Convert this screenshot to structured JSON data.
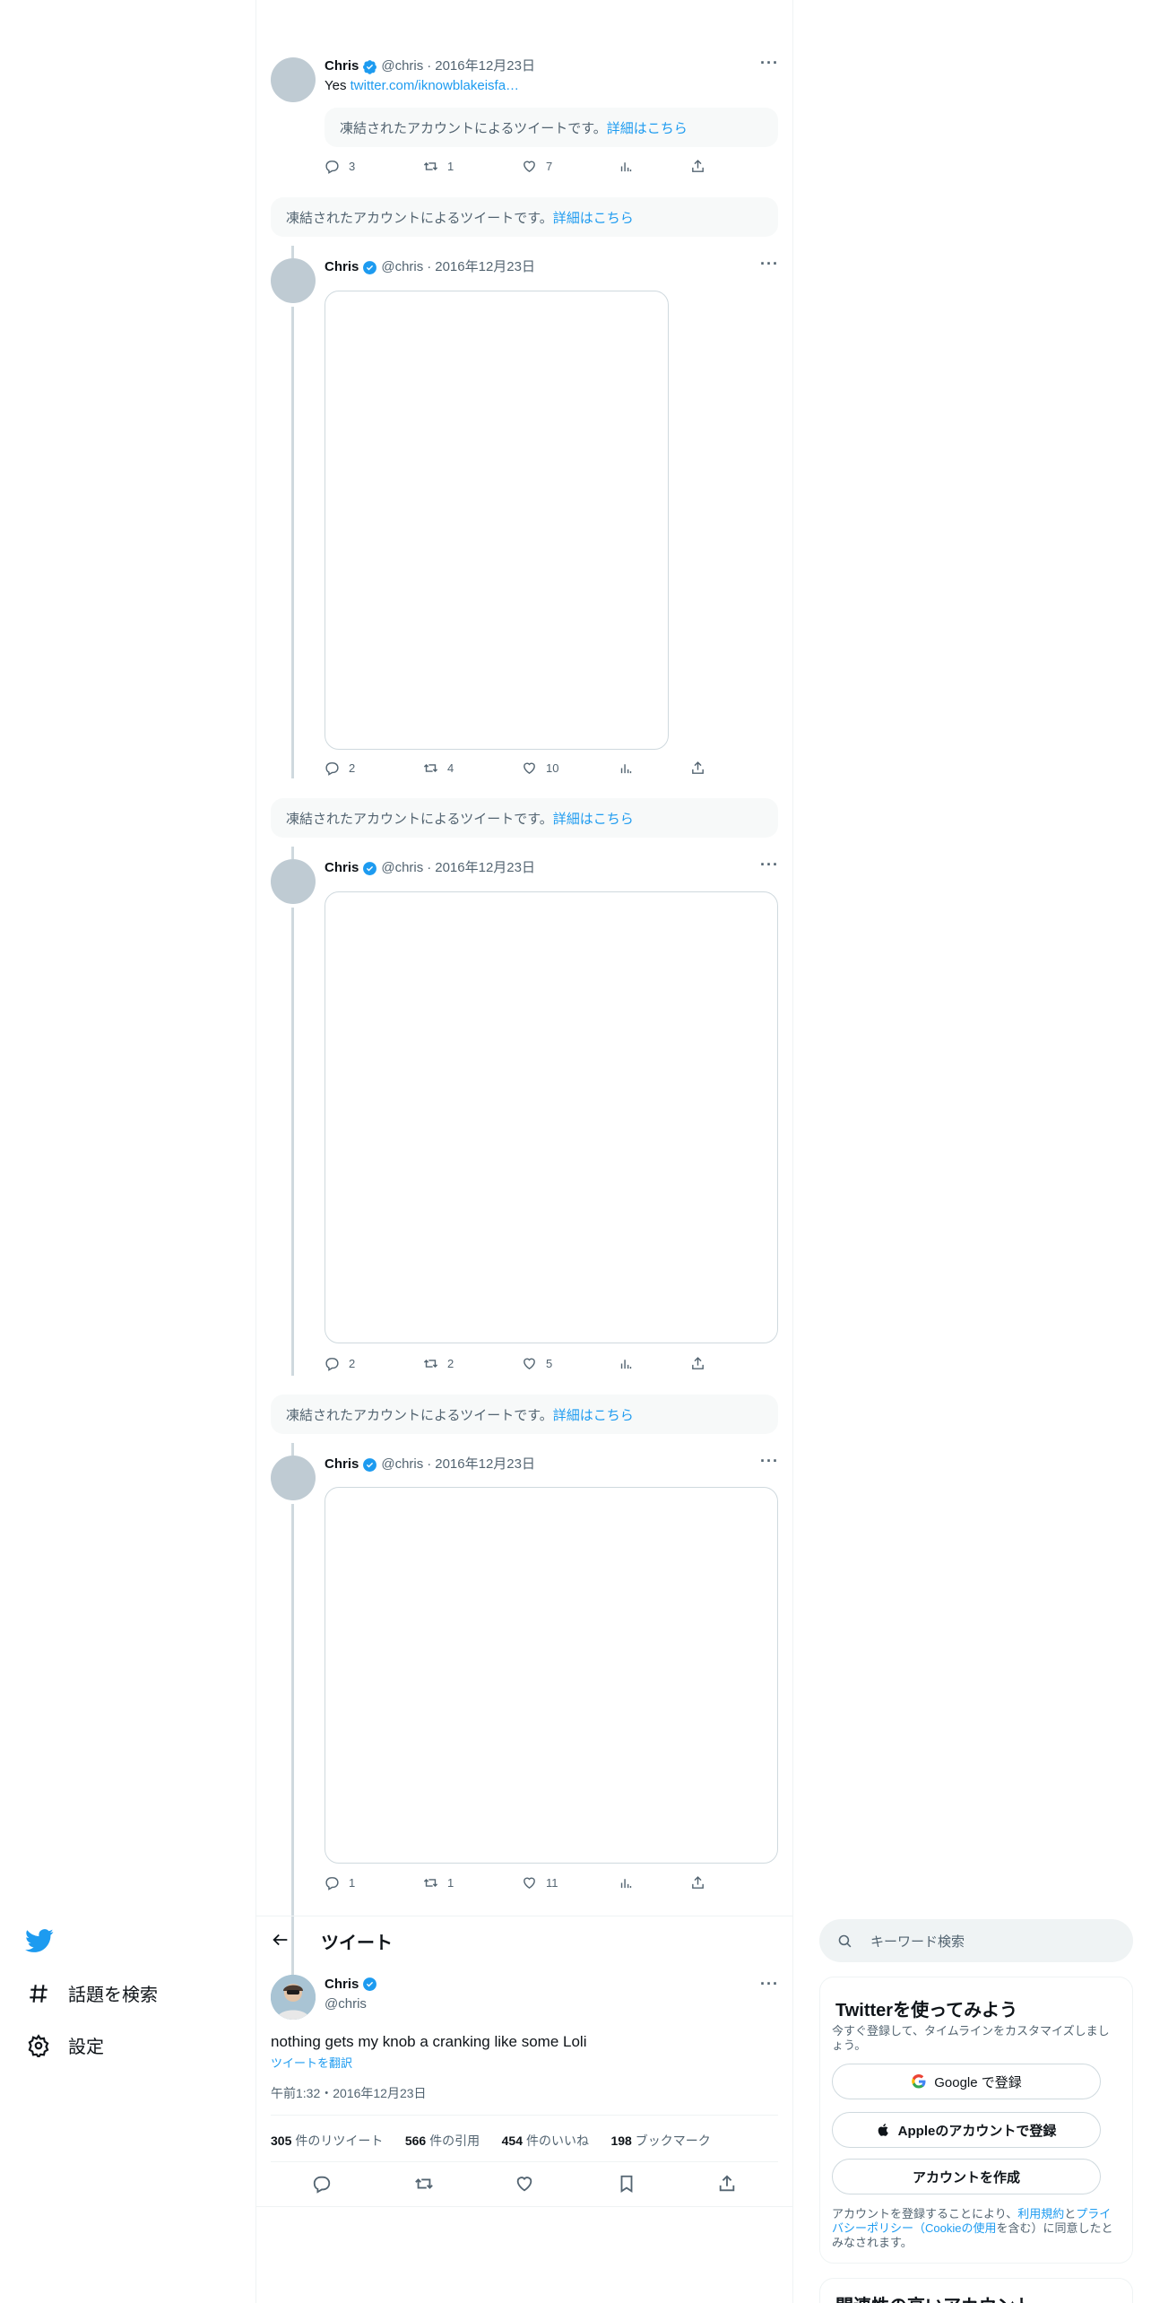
{
  "thread": {
    "tweets": [
      {
        "name": "Chris",
        "handle": "@chris",
        "sep": "·",
        "date": "2016年12月23日",
        "text_prefix": "Yes ",
        "link": "twitter.com/iknowblakeisfa…",
        "quote_notice": "凍結されたアカウントによるツイートです。",
        "quote_link": "詳細はこちら",
        "replies": "3",
        "retweets": "1",
        "likes": "7"
      },
      {
        "name": "Chris",
        "handle": "@chris",
        "sep": "·",
        "date": "2016年12月23日",
        "replies": "2",
        "retweets": "4",
        "likes": "10"
      },
      {
        "name": "Chris",
        "handle": "@chris",
        "sep": "·",
        "date": "2016年12月23日",
        "replies": "2",
        "retweets": "2",
        "likes": "5"
      },
      {
        "name": "Chris",
        "handle": "@chris",
        "sep": "·",
        "date": "2016年12月23日",
        "replies": "1",
        "retweets": "1",
        "likes": "11"
      }
    ],
    "suspended_notice": "凍結されたアカウントによるツイートです。",
    "suspended_link": "詳細はこちら"
  },
  "header": {
    "title": "ツイート"
  },
  "main_tweet": {
    "name": "Chris",
    "handle": "@chris",
    "text": "nothing gets my knob a cranking like some Loli",
    "translate": "ツイートを翻訳",
    "timestamp": "午前1:32・2016年12月23日",
    "retweets_count": "305",
    "retweets_label": "件のリツイート",
    "quotes_count": "566",
    "quotes_label": "件の引用",
    "likes_count": "454",
    "likes_label": "件のいいね",
    "bookmarks_count": "198",
    "bookmarks_label": "ブックマーク"
  },
  "sidebar": {
    "explore": "話題を検索",
    "settings": "設定"
  },
  "right": {
    "search_placeholder": "キーワード検索",
    "signup_title": "Twitterを使ってみよう",
    "signup_desc": "今すぐ登録して、タイムラインをカスタマイズしましょう。",
    "google_btn": "Google で登録",
    "apple_btn": "Appleのアカウントで登録",
    "create_btn": "アカウントを作成",
    "terms_1": "アカウントを登録することにより、",
    "terms_link1": "利用規約",
    "terms_2": "と",
    "terms_link2": "プライバシーポリシー（Cookieの使用",
    "terms_3": "を含む）に同意したとみなされます。",
    "related_title": "関連性の高いアカウント"
  },
  "colors": {
    "accent": "#1d9bf0",
    "text": "#0f1419",
    "muted": "#536471",
    "border": "#eff3f4"
  }
}
